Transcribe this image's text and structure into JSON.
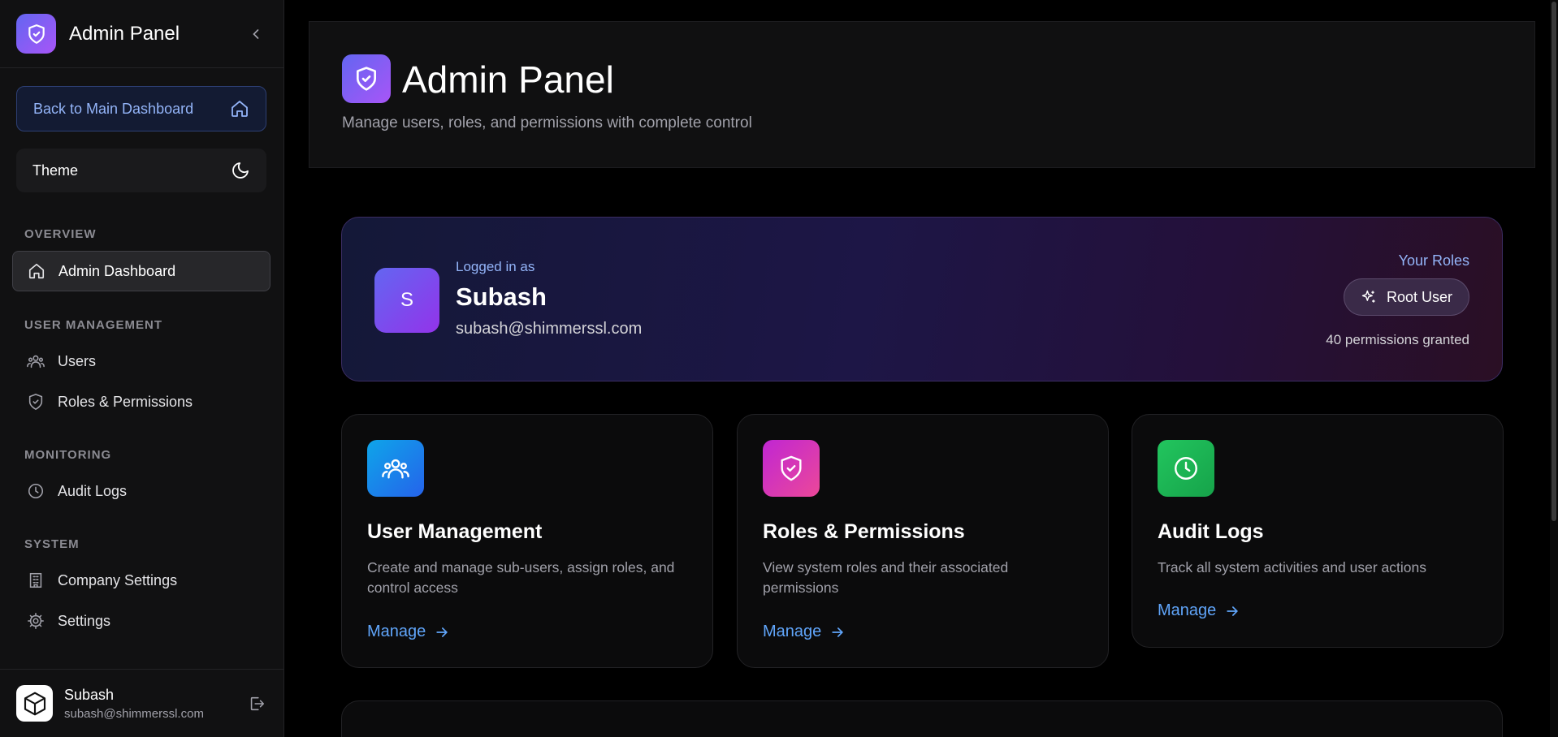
{
  "sidebar": {
    "title": "Admin Panel",
    "back_label": "Back to Main Dashboard",
    "theme_label": "Theme",
    "sections": {
      "overview": "OVERVIEW",
      "user_management": "USER MANAGEMENT",
      "monitoring": "MONITORING",
      "system": "SYSTEM"
    },
    "items": {
      "admin_dashboard": "Admin Dashboard",
      "users": "Users",
      "roles": "Roles & Permissions",
      "audit_logs": "Audit Logs",
      "company_settings": "Company Settings",
      "settings": "Settings"
    },
    "footer": {
      "name": "Subash",
      "email": "subash@shimmerssl.com"
    }
  },
  "header": {
    "title": "Admin Panel",
    "subtitle": "Manage users, roles, and permissions with complete control"
  },
  "user_card": {
    "avatar_letter": "S",
    "logged_in_label": "Logged in as",
    "name": "Subash",
    "email": "subash@shimmerssl.com",
    "roles_label": "Your Roles",
    "role": "Root User",
    "permissions": "40 permissions granted"
  },
  "features": [
    {
      "title": "User Management",
      "description": "Create and manage sub-users, assign roles, and control access",
      "link": "Manage",
      "icon": "users-icon",
      "color": "#0ea5e9"
    },
    {
      "title": "Roles & Permissions",
      "description": "View system roles and their associated permissions",
      "link": "Manage",
      "icon": "shield-check-icon",
      "color": "#d946ef"
    },
    {
      "title": "Audit Logs",
      "description": "Track all system activities and user actions",
      "link": "Manage",
      "icon": "clock-icon",
      "color": "#22c55e"
    }
  ],
  "colors": {
    "accent": "#6366f1",
    "link": "#60a5fa",
    "background": "#000000",
    "sidebar_bg": "#111112"
  }
}
